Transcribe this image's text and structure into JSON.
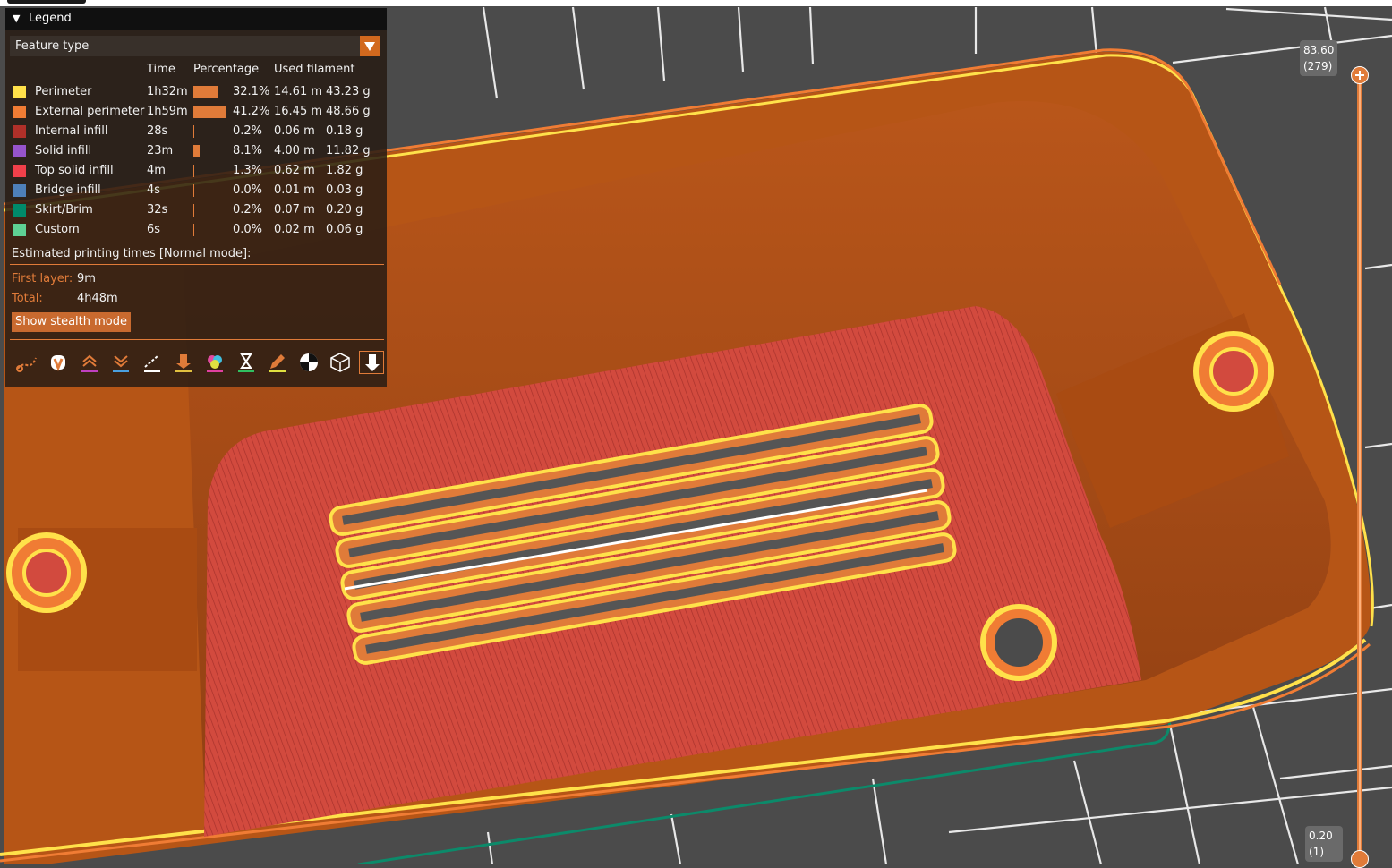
{
  "legend": {
    "title": "Legend",
    "view_type": "Feature type",
    "columns": {
      "time": "Time",
      "percentage": "Percentage",
      "used_filament": "Used filament"
    },
    "rows": [
      {
        "name": "Perimeter",
        "color": "#ffe14a",
        "time": "1h32m",
        "percent": "32.1%",
        "percent_value": 32.1,
        "length": "14.61 m",
        "weight": "43.23 g"
      },
      {
        "name": "External perimeter",
        "color": "#f07c34",
        "time": "1h59m",
        "percent": "41.2%",
        "percent_value": 41.2,
        "length": "16.45 m",
        "weight": "48.66 g"
      },
      {
        "name": "Internal infill",
        "color": "#b03029",
        "time": "28s",
        "percent": "0.2%",
        "percent_value": 0.2,
        "length": "0.06 m",
        "weight": "0.18 g"
      },
      {
        "name": "Solid infill",
        "color": "#9654cc",
        "time": "23m",
        "percent": "8.1%",
        "percent_value": 8.1,
        "length": "4.00 m",
        "weight": "11.82 g"
      },
      {
        "name": "Top solid infill",
        "color": "#f0404a",
        "time": "4m",
        "percent": "1.3%",
        "percent_value": 1.3,
        "length": "0.62 m",
        "weight": "1.82 g"
      },
      {
        "name": "Bridge infill",
        "color": "#4d80ba",
        "time": "4s",
        "percent": "0.0%",
        "percent_value": 0.0,
        "length": "0.01 m",
        "weight": "0.03 g"
      },
      {
        "name": "Skirt/Brim",
        "color": "#008a6a",
        "time": "32s",
        "percent": "0.2%",
        "percent_value": 0.2,
        "length": "0.07 m",
        "weight": "0.20 g"
      },
      {
        "name": "Custom",
        "color": "#5ed194",
        "time": "6s",
        "percent": "0.0%",
        "percent_value": 0.0,
        "length": "0.02 m",
        "weight": "0.06 g"
      }
    ],
    "estimated_title": "Estimated printing times [Normal mode]:",
    "first_layer_label": "First layer:",
    "first_layer_value": "9m",
    "total_label": "Total:",
    "total_value": "4h48m",
    "stealth_button": "Show stealth mode",
    "toolbar_icons": [
      "travel-icon",
      "wipe-icon",
      "retractions-icon",
      "deretractions-icon",
      "seams-icon",
      "tool-changes-icon",
      "color-changes-icon",
      "pause-prints-icon",
      "custom-gcodes-icon",
      "center-of-gravity-icon",
      "shells-icon",
      "tool-marker-icon"
    ]
  },
  "slider": {
    "top_value": "83.60",
    "top_layer": "(279)",
    "bottom_value": "0.20",
    "bottom_layer": "(1)"
  },
  "colors": {
    "accent": "#e07b39",
    "model": "#c15c18",
    "top_infill": "#d0453a",
    "bed": "#4a4a4a"
  }
}
